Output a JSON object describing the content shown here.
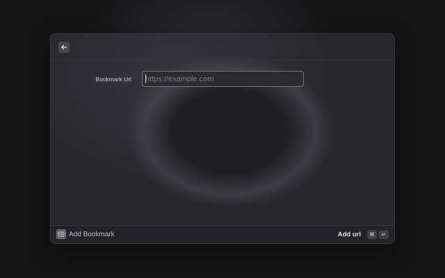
{
  "header": {
    "back_icon": "arrow-left-icon"
  },
  "form": {
    "bookmark_url_label": "Bookmark Url",
    "bookmark_url_value": "",
    "bookmark_url_placeholder": "https://example.com"
  },
  "footer": {
    "app_icon": "bookmark-app-icon",
    "title": "Add Bookmark",
    "action_label": "Add url",
    "shortcut_keys": [
      "⌘",
      "↵"
    ]
  },
  "colors": {
    "background": "#151516",
    "window": "#27272c",
    "input_border": "#77767d",
    "text_primary": "#e2e2e6",
    "text_muted": "#7c7c83"
  }
}
